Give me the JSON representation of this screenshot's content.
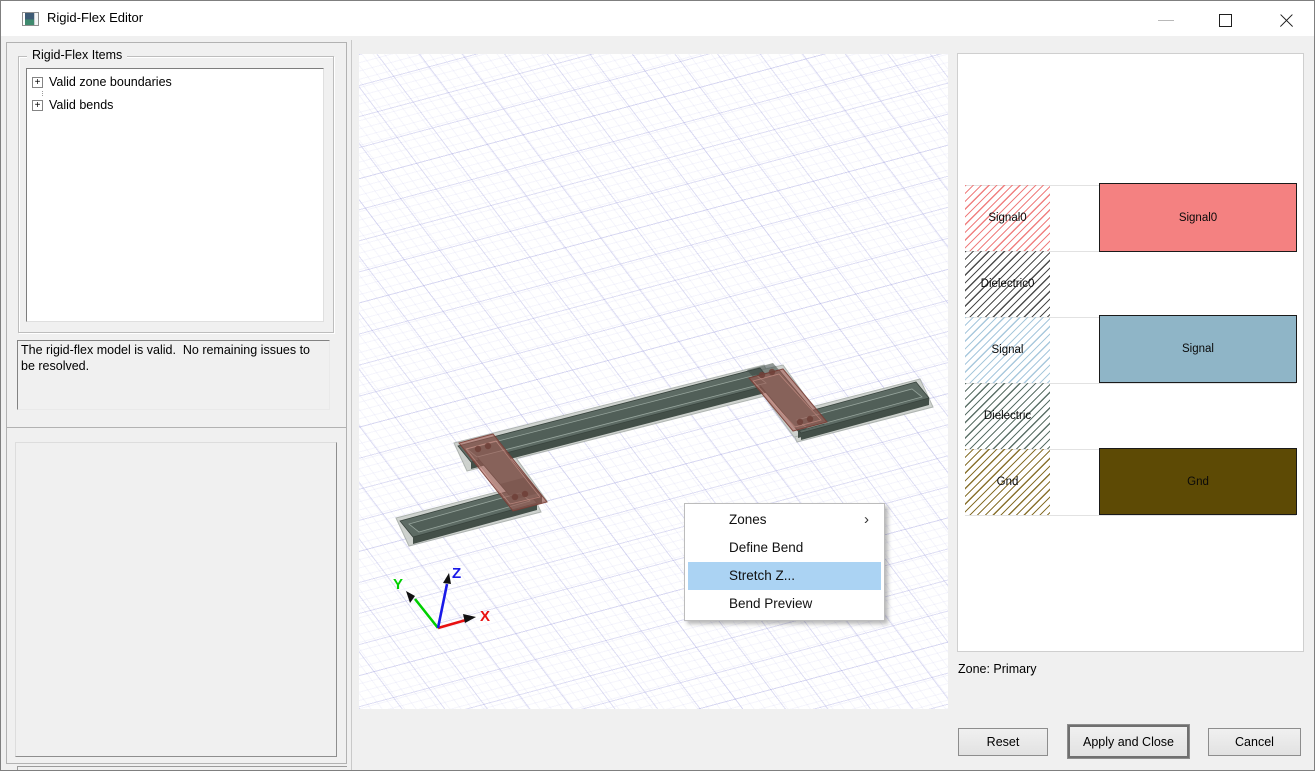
{
  "window": {
    "title": "Rigid-Flex Editor"
  },
  "left_panel": {
    "group_title": "Rigid-Flex Items",
    "tree_items": [
      {
        "expander": "+",
        "label": "Valid zone boundaries"
      },
      {
        "expander": "+",
        "label": "Valid bends"
      }
    ],
    "status_message": "The rigid-flex model is valid.  No remaining issues to be resolved."
  },
  "viewport": {
    "axes": {
      "x_label": "X",
      "y_label": "Y",
      "z_label": "Z"
    },
    "axis_colors": {
      "x": "#e81010",
      "y": "#00cf00",
      "z": "#1919e8"
    },
    "bend_zone_color": "#a55c52",
    "board_color": "#5d6b64"
  },
  "context_menu": {
    "items": [
      {
        "label": "Zones",
        "has_submenu": true,
        "highlighted": false
      },
      {
        "label": "Define Bend",
        "has_submenu": false,
        "highlighted": false
      },
      {
        "label": "Stretch Z...",
        "has_submenu": false,
        "highlighted": true
      },
      {
        "label": "Bend Preview",
        "has_submenu": false,
        "highlighted": false
      }
    ],
    "submenu_arrow": "›",
    "highlight_color": "#abd3f3"
  },
  "stackup": {
    "layers": [
      {
        "name": "Signal0",
        "kind": "signal",
        "hatch_color": "#f08080",
        "fill_color": "#f48181"
      },
      {
        "name": "Dielectric0",
        "kind": "dielectric",
        "hatch_color": "#4d4d4d",
        "fill_color": ""
      },
      {
        "name": "Signal",
        "kind": "signal",
        "hatch_color": "#a9c9dd",
        "fill_color": "#8fb5c7"
      },
      {
        "name": "Dielectric",
        "kind": "dielectric",
        "hatch_color": "#5d7269",
        "fill_color": ""
      },
      {
        "name": "Gnd",
        "kind": "signal",
        "hatch_color": "#8a7330",
        "fill_color": "#5d4a05"
      }
    ]
  },
  "footer": {
    "zone_label": "Zone: Primary",
    "buttons": [
      {
        "label": "Reset",
        "default": false
      },
      {
        "label": "Apply and Close",
        "default": true
      },
      {
        "label": "Cancel",
        "default": false
      }
    ]
  }
}
